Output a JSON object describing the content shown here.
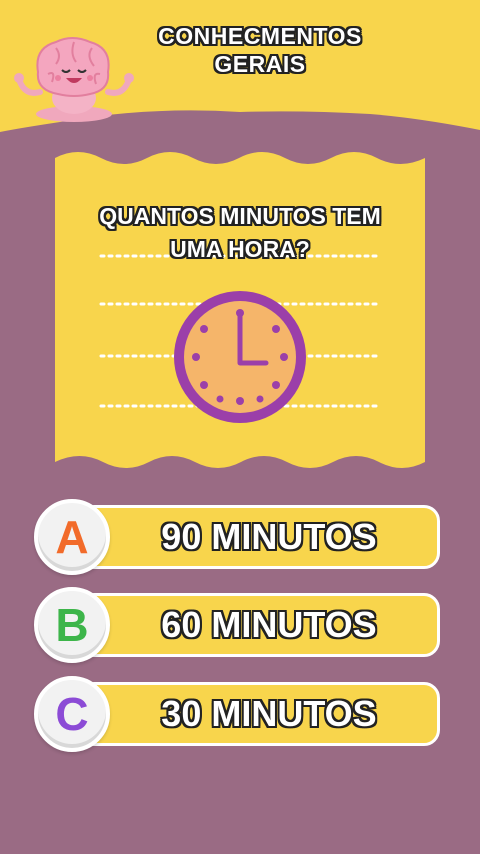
{
  "header": {
    "title_line1": "CONHECMENTOS",
    "title_line2": "GERAIS"
  },
  "question": {
    "line1": "QUANTOS MINUTOS TEM",
    "line2": "UMA HORA?"
  },
  "answers": [
    {
      "letter": "A",
      "text": "90 MINUTOS",
      "letter_color": "#f26b2a"
    },
    {
      "letter": "B",
      "text": "60 MINUTOS",
      "letter_color": "#3db54a"
    },
    {
      "letter": "C",
      "text": "30 MINUTOS",
      "letter_color": "#8c4bd6"
    }
  ],
  "colors": {
    "background": "#9a6b84",
    "header": "#f8d54c",
    "card": "#f8d54c",
    "clock_face": "#f5b56a",
    "clock_rim": "#9b3fa9"
  },
  "icons": [
    "brain-mascot-icon",
    "clock-icon"
  ]
}
